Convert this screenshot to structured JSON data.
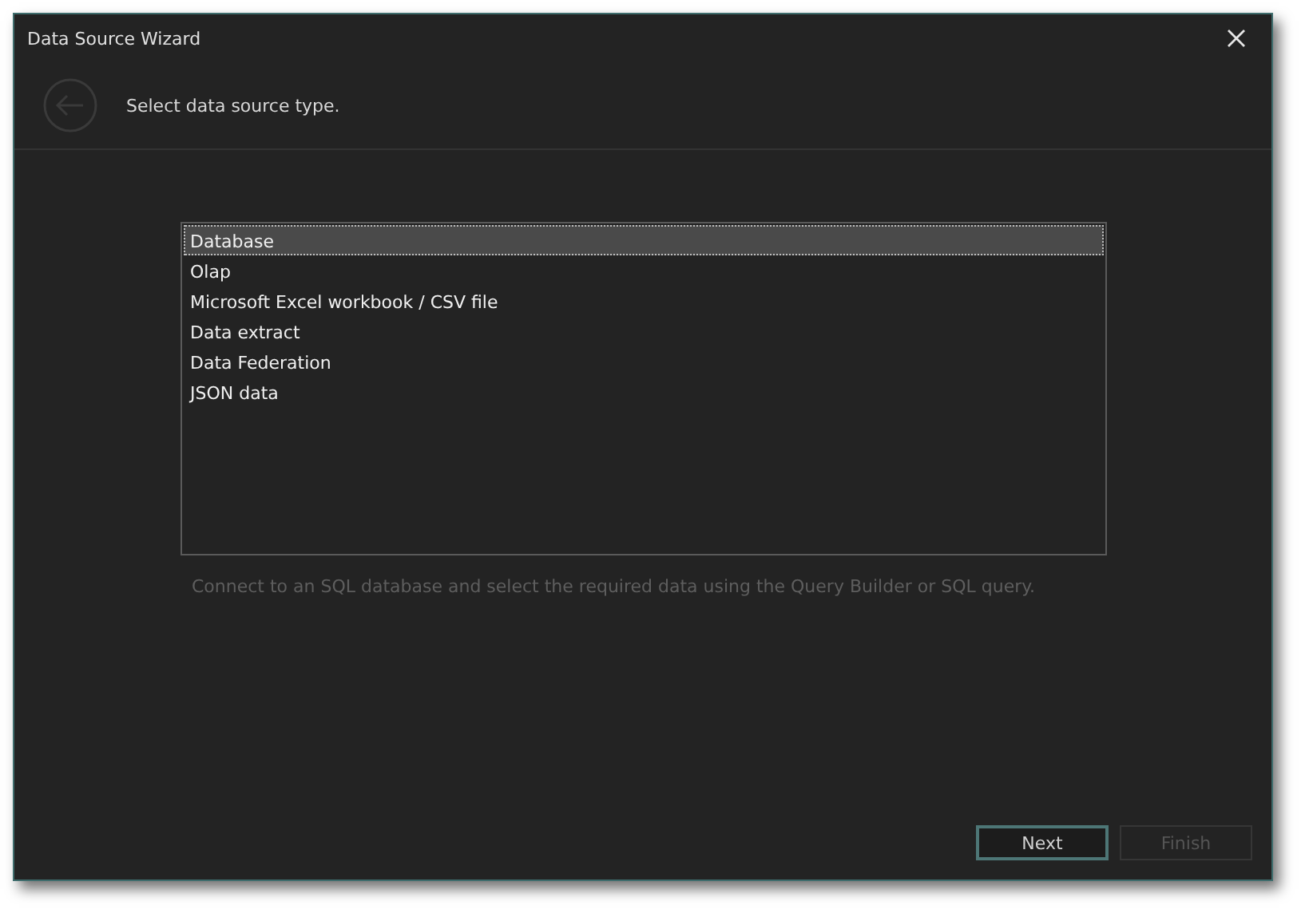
{
  "window": {
    "title": "Data Source Wizard"
  },
  "header": {
    "back_button": {
      "disabled": true
    },
    "prompt": "Select data source type."
  },
  "source_types": [
    {
      "label": "Database",
      "selected": true
    },
    {
      "label": "Olap",
      "selected": false
    },
    {
      "label": "Microsoft Excel workbook / CSV file",
      "selected": false
    },
    {
      "label": "Data extract",
      "selected": false
    },
    {
      "label": "Data Federation",
      "selected": false
    },
    {
      "label": "JSON data",
      "selected": false
    }
  ],
  "description": "Connect to an SQL database and select the required data using the Query Builder or SQL query.",
  "buttons": [
    {
      "label": "Next",
      "disabled": false,
      "focused": true
    },
    {
      "label": "Finish",
      "disabled": true,
      "focused": false
    }
  ]
}
